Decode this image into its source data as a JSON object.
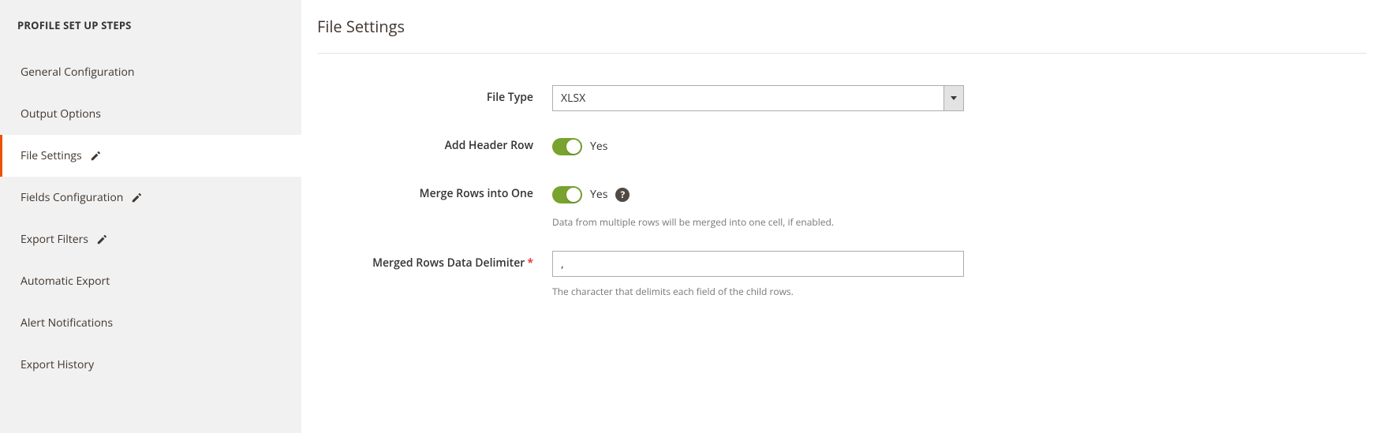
{
  "sidebar": {
    "title": "PROFILE SET UP STEPS",
    "items": [
      {
        "label": "General Configuration",
        "editable": false,
        "active": false
      },
      {
        "label": "Output Options",
        "editable": false,
        "active": false
      },
      {
        "label": "File Settings",
        "editable": true,
        "active": true
      },
      {
        "label": "Fields Configuration",
        "editable": true,
        "active": false
      },
      {
        "label": "Export Filters",
        "editable": true,
        "active": false
      },
      {
        "label": "Automatic Export",
        "editable": false,
        "active": false
      },
      {
        "label": "Alert Notifications",
        "editable": false,
        "active": false
      },
      {
        "label": "Export History",
        "editable": false,
        "active": false
      }
    ]
  },
  "main": {
    "title": "File Settings",
    "fileType": {
      "label": "File Type",
      "value": "XLSX"
    },
    "addHeader": {
      "label": "Add Header Row",
      "state": "Yes"
    },
    "mergeRows": {
      "label": "Merge Rows into One",
      "state": "Yes",
      "hint": "Data from multiple rows will be merged into one cell, if enabled."
    },
    "delimiter": {
      "label": "Merged Rows Data Delimiter",
      "value": ",",
      "hint": "The character that delimits each field of the child rows."
    }
  }
}
